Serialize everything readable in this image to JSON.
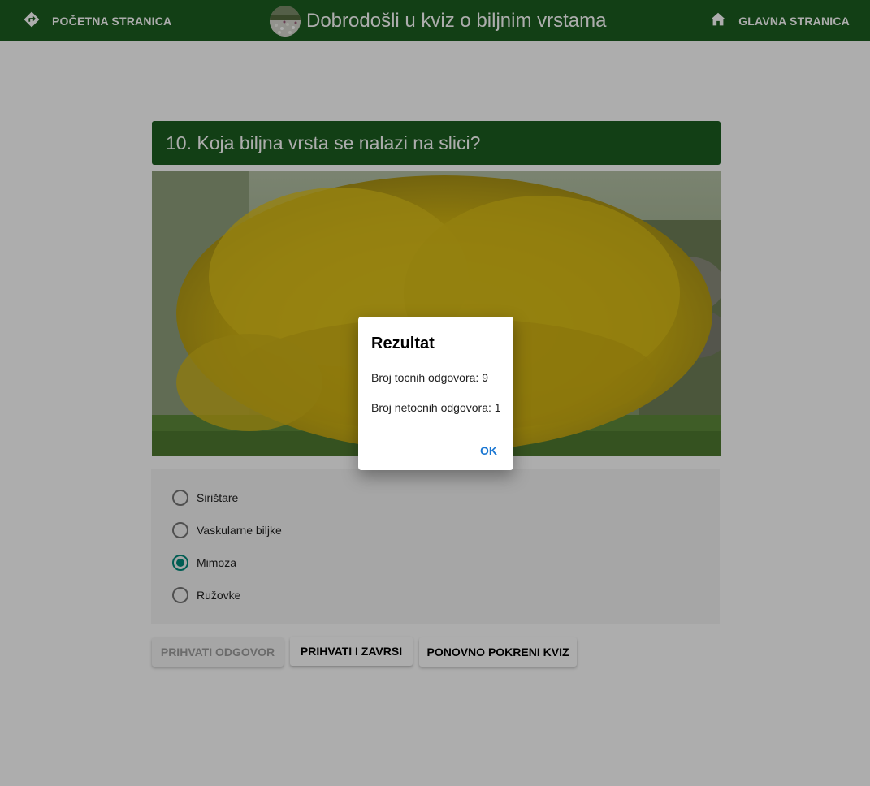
{
  "header": {
    "nav_left": {
      "label": "POČETNA STRANICA",
      "icon": "directions-icon"
    },
    "title": "Dobrodošli u kviz o biljnim vrstama",
    "nav_right": {
      "label": "GLAVNA STRANICA",
      "icon": "home-icon"
    }
  },
  "question": {
    "text": "10. Koja biljna vrsta se nalazi na slici?"
  },
  "answers": [
    {
      "label": "Sirištare",
      "selected": false
    },
    {
      "label": "Vaskularne biljke",
      "selected": false
    },
    {
      "label": "Mimoza",
      "selected": true
    },
    {
      "label": "Ružovke",
      "selected": false
    }
  ],
  "buttons": {
    "accept": "PRIHVATI ODGOVOR",
    "accept_finish": "PRIHVATI I ZAVRSI",
    "restart": "PONOVNO POKRENI KVIZ"
  },
  "dialog": {
    "title": "Rezultat",
    "correct": "Broj tocnih odgovora: 9",
    "incorrect": "Broj netocnih odgovora: 1",
    "ok": "OK"
  },
  "colors": {
    "primary": "#1b5e20",
    "radio_accent": "#00897b",
    "dialog_action": "#1976d2"
  }
}
